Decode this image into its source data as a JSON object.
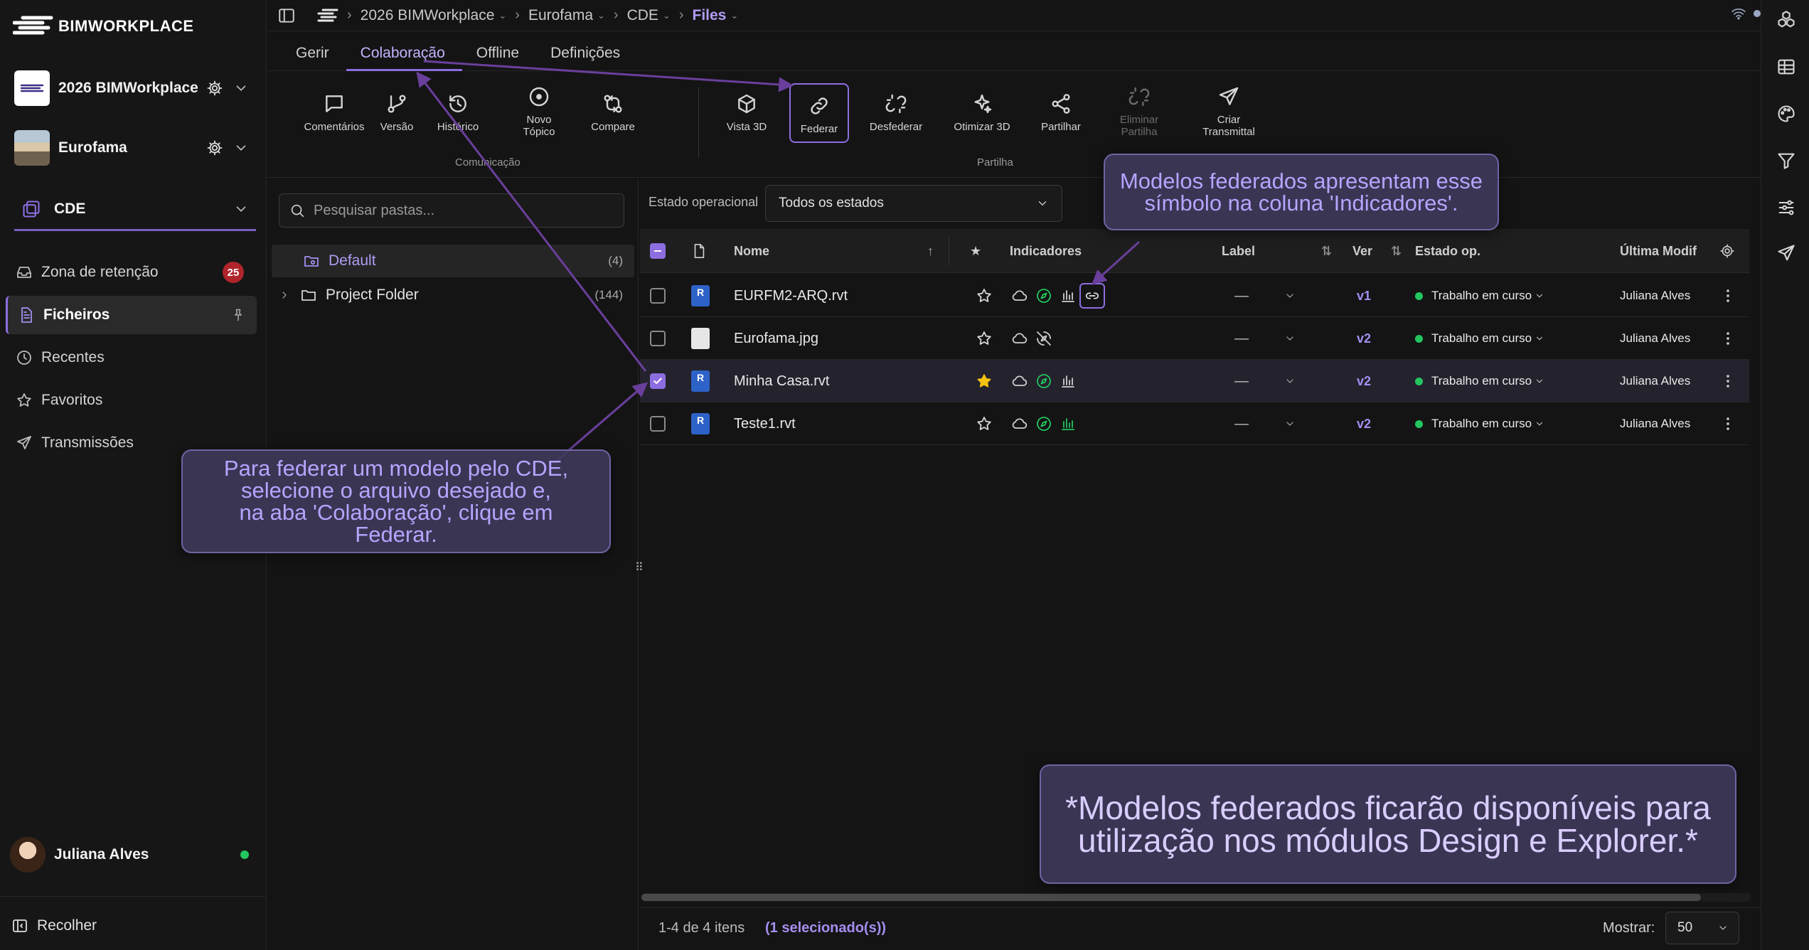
{
  "app": {
    "logo_text": "BIMWORKPLACE"
  },
  "sidebar": {
    "workspace": "2026 BIMWorkplace",
    "project": "Eurofama",
    "module": "CDE",
    "nav": [
      {
        "label": "Zona de retenção",
        "badge": "25"
      },
      {
        "label": "Ficheiros"
      },
      {
        "label": "Recentes"
      },
      {
        "label": "Favoritos"
      },
      {
        "label": "Transmissões"
      }
    ],
    "user": "Juliana Alves",
    "collapse": "Recolher"
  },
  "breadcrumb": [
    "2026 BIMWorkplace",
    "Eurofama",
    "CDE",
    "Files"
  ],
  "tabs": [
    "Gerir",
    "Colaboração",
    "Offline",
    "Definições"
  ],
  "toolbar": {
    "comunicacao": {
      "label": "Comunicação",
      "tools": [
        "Comentários",
        "Versão",
        "Histórico",
        "Novo\nTópico",
        "Compare"
      ]
    },
    "partilha": {
      "label": "Partilha",
      "tools": [
        "Vista 3D",
        "Federar",
        "Desfederar",
        "Otimizar 3D",
        "Partilhar",
        "Eliminar\nPartilha",
        "Criar\nTransmittal"
      ]
    }
  },
  "folders": {
    "search_placeholder": "Pesquisar pastas...",
    "items": [
      {
        "name": "Default",
        "count": "(4)"
      },
      {
        "name": "Project Folder",
        "count": "(144)"
      }
    ]
  },
  "filter": {
    "label": "Estado operacional",
    "value": "Todos os estados"
  },
  "table": {
    "headers": {
      "name": "Nome",
      "star": "★",
      "indicators": "Indicadores",
      "label": "Label",
      "ver": "Ver",
      "status": "Estado op.",
      "modified": "Última Modif"
    },
    "rows": [
      {
        "name": "EURFM2-ARQ.rvt",
        "label": "—",
        "ver": "v1",
        "status": "Trabalho em curso",
        "modified": "Juliana Alves"
      },
      {
        "name": "Eurofama.jpg",
        "label": "—",
        "ver": "v2",
        "status": "Trabalho em curso",
        "modified": "Juliana Alves"
      },
      {
        "name": "Minha Casa.rvt",
        "label": "—",
        "ver": "v2",
        "status": "Trabalho em curso",
        "modified": "Juliana Alves"
      },
      {
        "name": "Teste1.rvt",
        "label": "—",
        "ver": "v2",
        "status": "Trabalho em curso",
        "modified": "Juliana Alves"
      }
    ]
  },
  "footer": {
    "count": "1-4 de 4 itens",
    "selected": "(1 selecionado(s))",
    "show_label": "Mostrar:",
    "page_size": "50"
  },
  "callouts": {
    "federate": "Para federar um modelo pelo CDE,\nselecione o arquivo desejado e,\nna aba 'Colaboração', clique em Federar.",
    "symbol": "Modelos federados apresentam esse\nsímbolo na coluna 'Indicadores'.",
    "modules": "*Modelos federados ficarão disponíveis para\nutilização nos módulos Design e Explorer.*"
  },
  "colors": {
    "accent": "#8c6ee0",
    "accent_text": "#b29cf5",
    "status_green": "#22c55e",
    "badge_red": "#b0242c"
  }
}
